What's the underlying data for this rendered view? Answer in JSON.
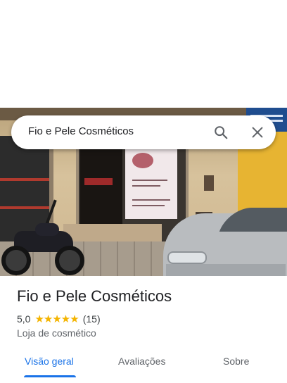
{
  "search": {
    "query": "Fio e Pele Cosméticos"
  },
  "place": {
    "name": "Fio e Pele Cosméticos",
    "rating": "5,0",
    "stars": "★★★★★",
    "reviews_count": "(15)",
    "category": "Loja de cosmético"
  },
  "tabs": [
    {
      "label": "Visão geral",
      "active": true
    },
    {
      "label": "Avaliações",
      "active": false
    },
    {
      "label": "Sobre",
      "active": false
    }
  ],
  "colors": {
    "accent": "#1a73e8",
    "star": "#f4b400"
  }
}
